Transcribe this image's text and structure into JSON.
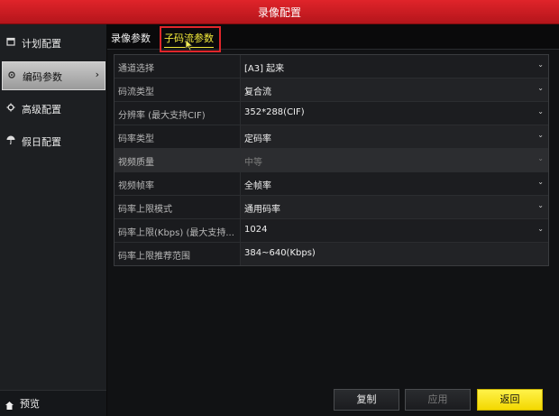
{
  "window": {
    "title": "录像配置"
  },
  "sidebar": {
    "items": [
      {
        "label": "计划配置",
        "icon": "calendar-icon",
        "active": false
      },
      {
        "label": "编码参数",
        "icon": "gear-icon",
        "active": true
      },
      {
        "label": "高级配置",
        "icon": "settings-icon",
        "active": false
      },
      {
        "label": "假日配置",
        "icon": "umbrella-icon",
        "active": false
      }
    ],
    "preview_label": "预览"
  },
  "tabs": [
    {
      "label": "录像参数",
      "active": false
    },
    {
      "label": "子码流参数",
      "active": true
    }
  ],
  "form": {
    "rows": [
      {
        "label": "通道选择",
        "value": "[A3] 起来",
        "dropdown": true
      },
      {
        "label": "码流类型",
        "value": "复合流",
        "dropdown": true
      },
      {
        "label": "分辨率 (最大支持CIF)",
        "value": "352*288(CIF)",
        "dropdown": true
      },
      {
        "label": "码率类型",
        "value": "定码率",
        "dropdown": true
      },
      {
        "label": "视频质量",
        "value": "中等",
        "dropdown": true,
        "disabled": true
      },
      {
        "label": "视频帧率",
        "value": "全帧率",
        "dropdown": true
      },
      {
        "label": "码率上限模式",
        "value": "通用码率",
        "dropdown": true
      },
      {
        "label": "码率上限(Kbps) (最大支持...",
        "value": "1024",
        "dropdown": true
      },
      {
        "label": "码率上限推荐范围",
        "value": "384~640(Kbps)",
        "dropdown": false
      }
    ]
  },
  "buttons": {
    "copy": "复制",
    "apply": "应用",
    "back": "返回"
  },
  "colors": {
    "title_bar": "#d11e24",
    "active_tab": "#f3ea3a",
    "highlight_box": "#e0262b",
    "back_button": "#f3e01a"
  }
}
